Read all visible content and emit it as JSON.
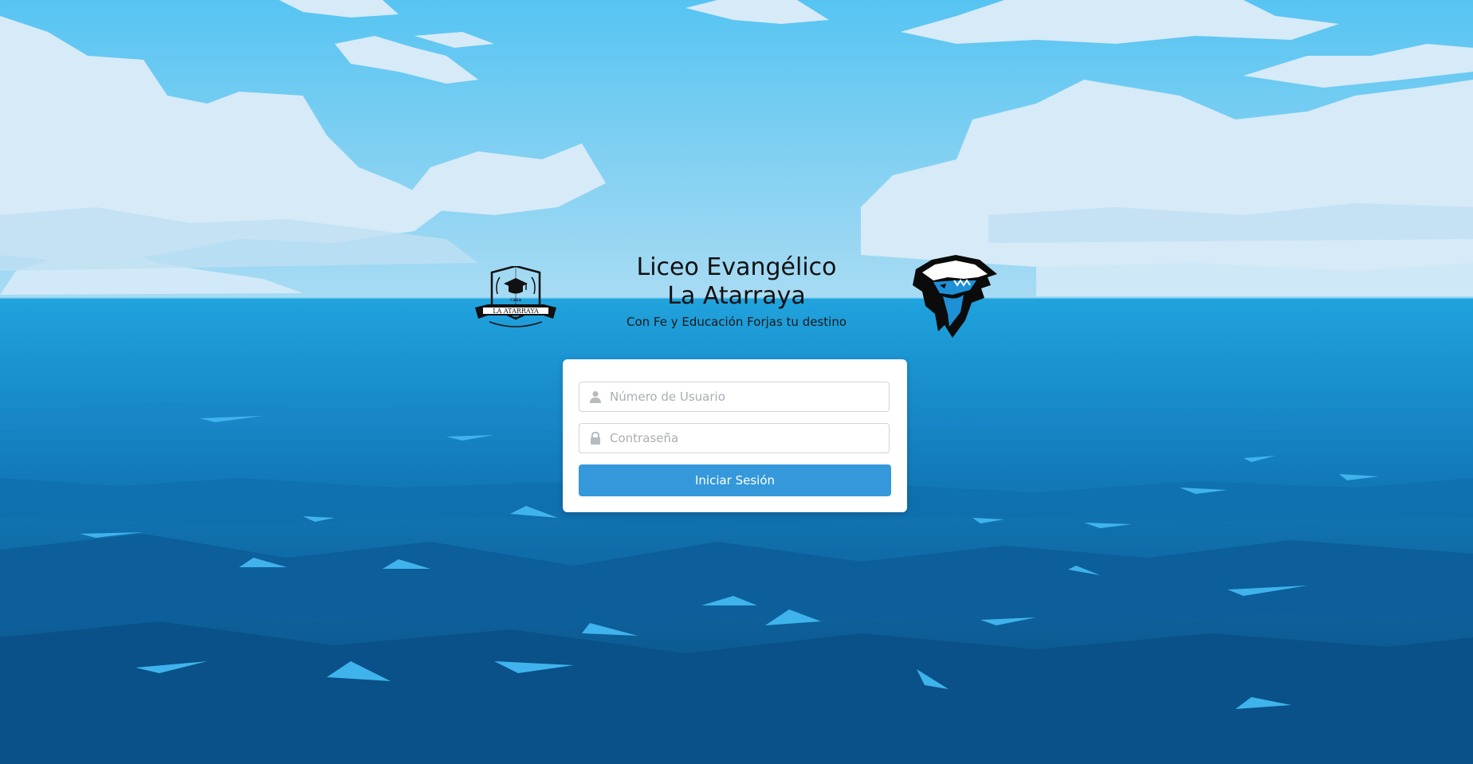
{
  "header": {
    "title_line1": "Liceo Evangélico",
    "title_line2": "La Atarraya",
    "subtitle": "Con Fe y Educación Forjas tu destino",
    "logo_left_name": "casa-la-atarraya-crest",
    "logo_left_text": "LA ATARRAYA",
    "logo_left_small_text": "casa",
    "logo_right_name": "shark-mascot-logo"
  },
  "login": {
    "username_placeholder": "Número de Usuario",
    "username_value": "",
    "username_icon": "user-icon",
    "password_placeholder": "Contraseña",
    "password_value": "",
    "password_icon": "lock-icon",
    "submit_label": "Iniciar Sesión"
  },
  "colors": {
    "sky_top": "#5bc7f0",
    "cloud": "#d8ecf8",
    "ocean_top": "#1ea0dc",
    "ocean_bottom": "#0a4f86",
    "button": "#3498db",
    "card": "#ffffff"
  }
}
